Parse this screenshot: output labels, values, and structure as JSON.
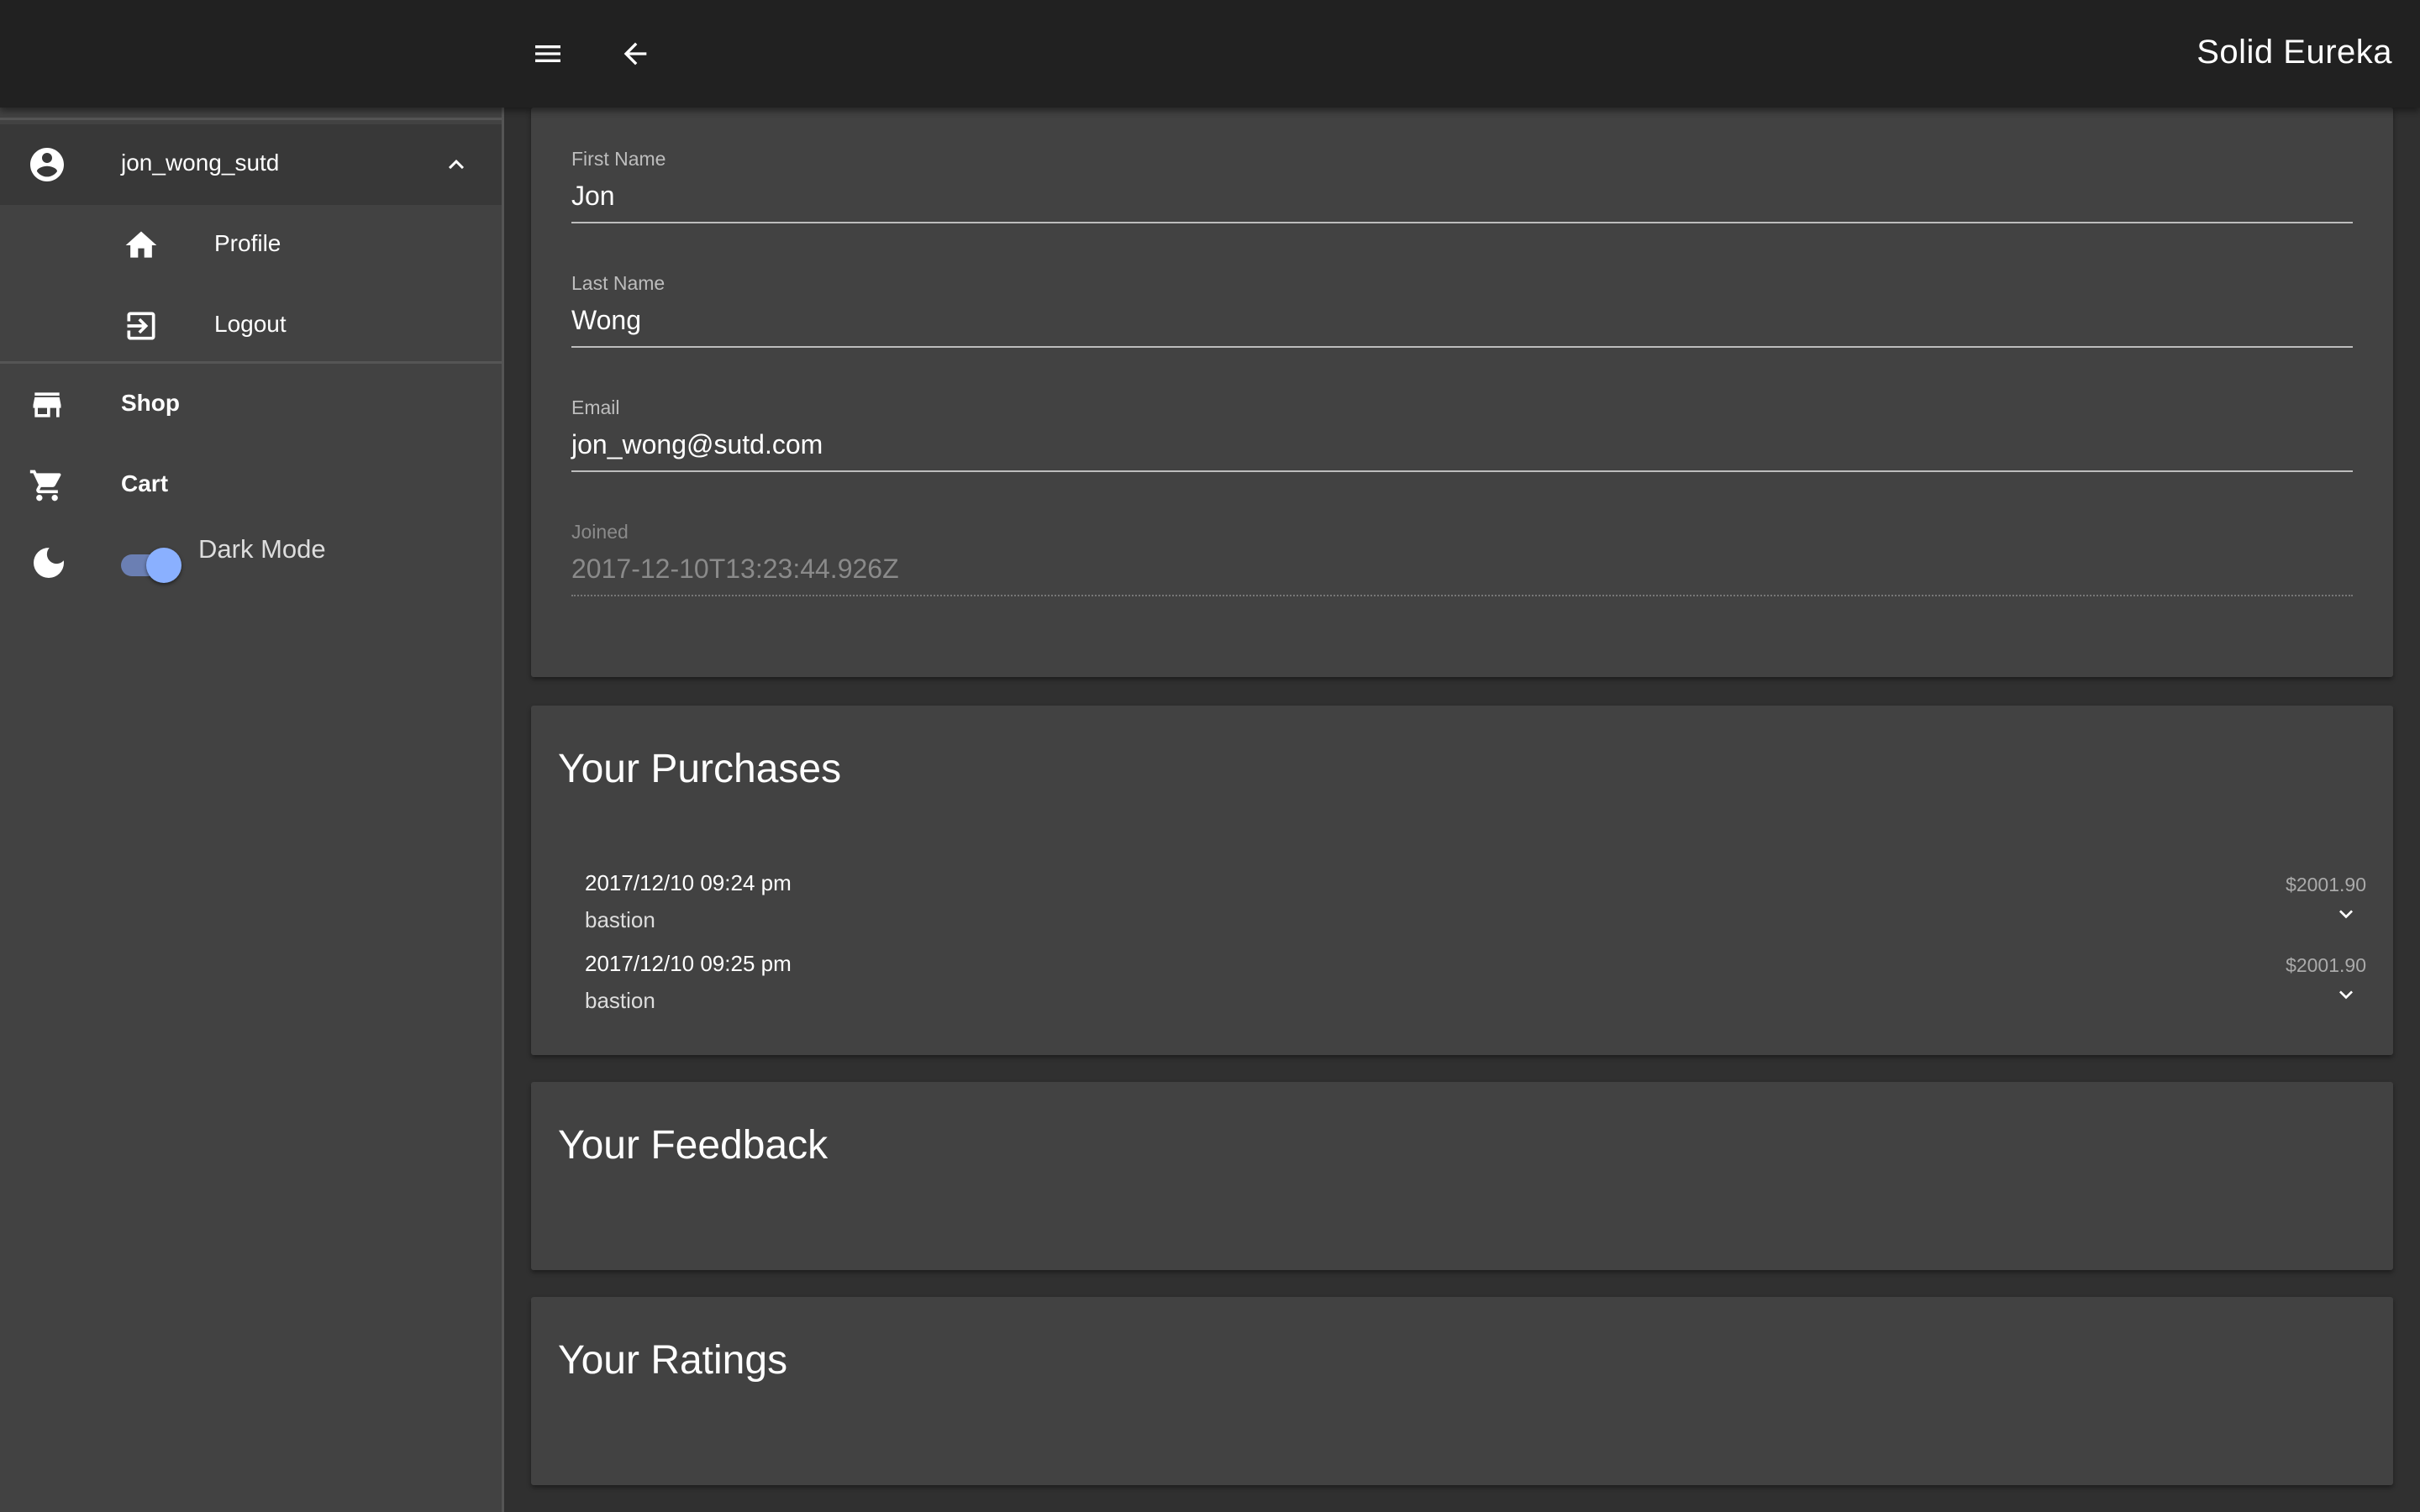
{
  "appbar": {
    "title": "Solid Eureka",
    "menu_icon": "menu-icon",
    "back_icon": "arrow-back-icon"
  },
  "drawer": {
    "user": {
      "label": "jon_wong_sutd",
      "icon": "account-circle-icon",
      "expand_icon": "chevron-up-icon"
    },
    "sub_items": [
      {
        "label": "Profile",
        "icon": "home-icon"
      },
      {
        "label": "Logout",
        "icon": "exit-to-app-icon"
      }
    ],
    "nav_items": [
      {
        "label": "Shop",
        "icon": "store-icon"
      },
      {
        "label": "Cart",
        "icon": "cart-icon"
      }
    ],
    "dark_mode": {
      "label": "Dark Mode",
      "icon": "moon-icon",
      "enabled": true
    }
  },
  "profile": {
    "fields": [
      {
        "label": "First Name",
        "value": "Jon"
      },
      {
        "label": "Last Name",
        "value": "Wong"
      },
      {
        "label": "Email",
        "value": "jon_wong@sutd.com"
      },
      {
        "label": "Joined",
        "value": "2017-12-10T13:23:44.926Z"
      }
    ]
  },
  "purchases": {
    "title": "Your Purchases",
    "items": [
      {
        "date": "2017/12/10 09:24 pm",
        "item": "bastion",
        "price": "$2001.90"
      },
      {
        "date": "2017/12/10 09:25 pm",
        "item": "bastion",
        "price": "$2001.90"
      }
    ]
  },
  "feedback": {
    "title": "Your Feedback"
  },
  "ratings": {
    "title": "Your Ratings"
  },
  "colors": {
    "appbar_bg": "#212121",
    "drawer_bg": "#424242",
    "page_bg": "#303030",
    "card_bg": "#424242",
    "toggle_accent": "#8ab0ff"
  }
}
